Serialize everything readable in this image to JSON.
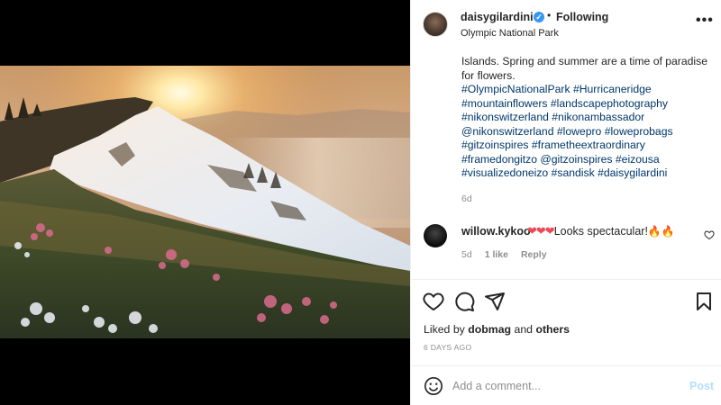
{
  "post": {
    "author": {
      "username": "daisygilardini",
      "verified_icon": "verified-badge-icon",
      "separator": "•",
      "follow_status": "Following",
      "location": "Olympic National Park"
    },
    "more_icon": "more-options-icon",
    "more_label": "•••",
    "caption": {
      "text_line1": "Islands. Spring and summer are a time of paradise",
      "text_line2": "for flowers.",
      "hashtags": [
        "#OlympicNationalPark #Hurricaneridge",
        "#mountainflowers #landscapephotography",
        "#nikonswitzerland #nikonambassador",
        "@nikonswitzerland #lowepro #loweprobags",
        "#gitzoinspires #frametheextraordinary",
        "#framedongitzo @gitzoinspires #eizousa",
        "#visualizedoneizo #sandisk #daisygilardini"
      ],
      "time": "6d"
    },
    "comment": {
      "username": "willow.kykoo",
      "hearts": "❤❤❤",
      "text": "Looks spectacular!",
      "fire": "🔥🔥",
      "time": "5d",
      "likes": "1 like",
      "reply": "Reply",
      "like_icon": "heart-outline-icon"
    },
    "actions": {
      "like_icon": "heart-outline-icon",
      "comment_icon": "comment-bubble-icon",
      "share_icon": "paper-plane-icon",
      "save_icon": "bookmark-icon"
    },
    "liked_by": {
      "prefix": "Liked by",
      "user": "dobmag",
      "and": "and",
      "others": "others"
    },
    "posted_ago": "6 DAYS AGO",
    "composer": {
      "emoji_icon": "smiley-face-icon",
      "placeholder": "Add a comment...",
      "post_label": "Post"
    }
  },
  "colors": {
    "link_blue": "#00376b",
    "verified_blue": "#3897f0",
    "muted": "#8e8e8e",
    "post_disabled": "#b2dffc",
    "heart_red": "#ed4956"
  }
}
